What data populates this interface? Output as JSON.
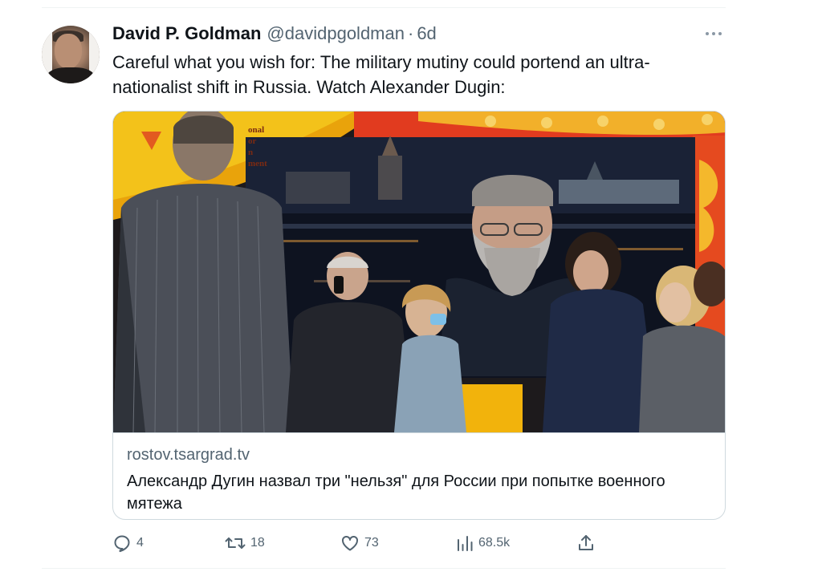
{
  "tweet": {
    "display_name": "David P. Goldman",
    "handle": "@davidpgoldman",
    "separator": "·",
    "time": "6d",
    "text": "Careful what you wish for: The military mutiny could portend an ultra-nationalist shift in Russia. Watch Alexander Dugin:"
  },
  "card": {
    "domain": "rostov.tsargrad.tv",
    "title": "Александр Дугин назвал три \"нельзя\" для России при попытке военного мятежа",
    "banner_text": [
      "onal",
      "or",
      "n",
      "ment"
    ]
  },
  "actions": {
    "reply_count": "4",
    "retweet_count": "18",
    "like_count": "73",
    "views_count": "68.5k"
  },
  "icons": [
    "more-icon",
    "reply-icon",
    "retweet-icon",
    "like-icon",
    "views-icon",
    "share-icon"
  ],
  "colors": {
    "text": "#0f1419",
    "secondary": "#536471",
    "border": "#cfd9de"
  }
}
